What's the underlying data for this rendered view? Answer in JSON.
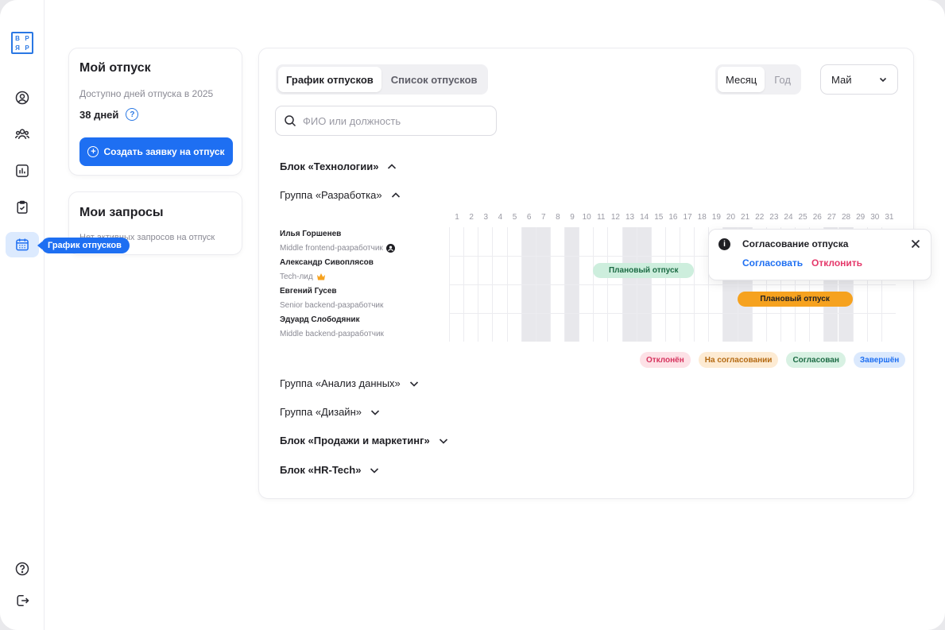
{
  "sidebar": {
    "logo_letters": [
      "В",
      "Р",
      "Я",
      "Р"
    ],
    "items": [
      {
        "icon": "user-circle-icon"
      },
      {
        "icon": "team-icon"
      },
      {
        "icon": "bar-chart-icon"
      },
      {
        "icon": "clipboard-check-icon"
      },
      {
        "icon": "calendar-icon",
        "active": true
      }
    ],
    "tooltip": "График отпусков",
    "bottom": [
      {
        "icon": "help-icon"
      },
      {
        "icon": "logout-icon"
      }
    ]
  },
  "my_vacation": {
    "title": "Мой отпуск",
    "available_label": "Доступно дней отпуска в 2025",
    "days": "38 дней",
    "create_button": "Создать заявку на отпуск"
  },
  "my_requests": {
    "title": "Мои запросы",
    "empty_text": "Нет активных запросов на отпуск"
  },
  "tabs": [
    "График отпусков",
    "Список отпусков"
  ],
  "period": [
    "Месяц",
    "Год"
  ],
  "month_select": {
    "value": "Май"
  },
  "search": {
    "placeholder": "ФИО или должность",
    "value": ""
  },
  "blocks": {
    "tech_block": "Блок «Технологии»",
    "dev_group": "Группа «Разработка»",
    "data_group": "Группа «Анализ данных»",
    "design_group": "Группа «Дизайн»",
    "sales_block": "Блок «Продажи и маркетинг»",
    "hr_block": "Блок «HR-Tech»"
  },
  "employees": [
    {
      "name": "Илья Горшенев",
      "role": "Middle frontend-разработчик"
    },
    {
      "name": "Александр Сивоплясов",
      "role": "Tech-лид"
    },
    {
      "name": "Евгений Гусев",
      "role": "Senior backend-разработчик"
    },
    {
      "name": "Эдуард Слободяник",
      "role": "Middle backend-разработчик"
    }
  ],
  "days": [
    "1",
    "2",
    "3",
    "4",
    "5",
    "6",
    "7",
    "8",
    "9",
    "10",
    "11",
    "12",
    "13",
    "14",
    "15",
    "16",
    "17",
    "18",
    "19",
    "20",
    "21",
    "22",
    "23",
    "24",
    "25",
    "26",
    "27",
    "28",
    "29",
    "30",
    "31"
  ],
  "weekend_days": [
    6,
    7,
    9,
    13,
    14,
    20,
    21,
    27,
    28
  ],
  "vacations": [
    {
      "employee": 1,
      "label": "Плановый отпуск",
      "start": 11,
      "end": 17,
      "status": "Согласован"
    },
    {
      "employee": 2,
      "label": "Плановый отпуск",
      "start": 21,
      "end": 28,
      "status": "pending-action"
    }
  ],
  "legend": [
    {
      "label": "Отклонён",
      "bg": "#fde1e6",
      "fg": "#d6335e"
    },
    {
      "label": "На согласовании",
      "bg": "#fdebd3",
      "fg": "#b46a12"
    },
    {
      "label": "Согласован",
      "bg": "#d8f1e3",
      "fg": "#1c6b44"
    },
    {
      "label": "Завершён",
      "bg": "#dbe9fd",
      "fg": "#1e6ff2"
    }
  ],
  "popover": {
    "title": "Согласование отпуска",
    "approve": "Согласовать",
    "reject": "Отклонить"
  },
  "colors": {
    "accent": "#1e6ff2",
    "planned_approved": "#cdeedd",
    "planned_pending": "#f6a21f"
  }
}
